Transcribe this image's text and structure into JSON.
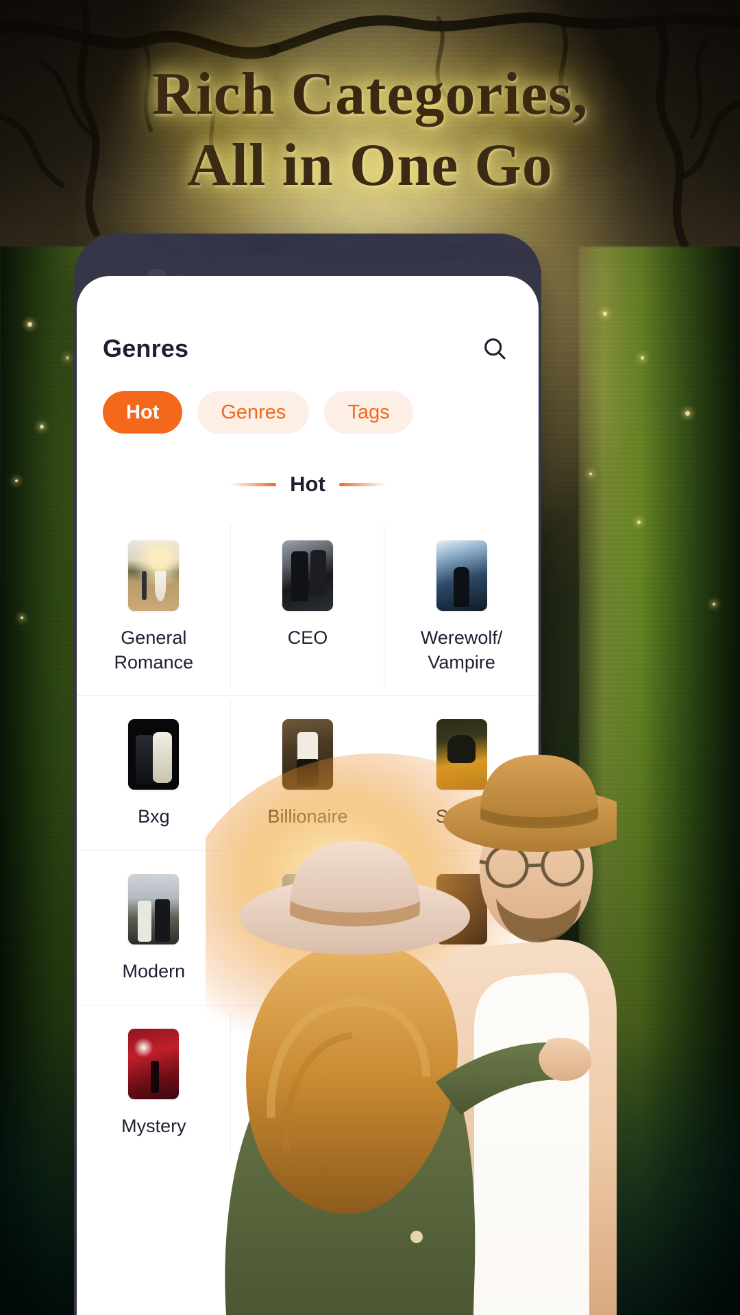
{
  "headline": {
    "line1": "Rich Categories,",
    "line2": "All in One Go"
  },
  "colors": {
    "accent": "#f4681b",
    "pill_idle_bg": "#fdefe6",
    "pill_idle_text": "#ef6a1c",
    "text_dark": "#1d2031",
    "bezel": "#353648",
    "divider": "#eceef1"
  },
  "app": {
    "title": "Genres",
    "search_icon": "search-icon",
    "tabs": [
      {
        "label": "Hot",
        "active": true
      },
      {
        "label": "Genres",
        "active": false
      },
      {
        "label": "Tags",
        "active": false
      }
    ],
    "section": {
      "title": "Hot"
    },
    "categories": [
      {
        "label": "General Romance",
        "art": "t-romance"
      },
      {
        "label": "CEO",
        "art": "t-ceo"
      },
      {
        "label": "Werewolf/ Vampire",
        "art": "t-were"
      },
      {
        "label": "Bxg",
        "art": "t-bxg"
      },
      {
        "label": "Billionaire",
        "art": "t-billion"
      },
      {
        "label": "Sweet",
        "art": "t-sweet"
      },
      {
        "label": "Modern",
        "art": "t-modern"
      },
      {
        "label": "",
        "art": "t-hidden1"
      },
      {
        "label": "",
        "art": "t-hidden2"
      },
      {
        "label": "Mystery",
        "art": "t-mystery"
      }
    ]
  }
}
